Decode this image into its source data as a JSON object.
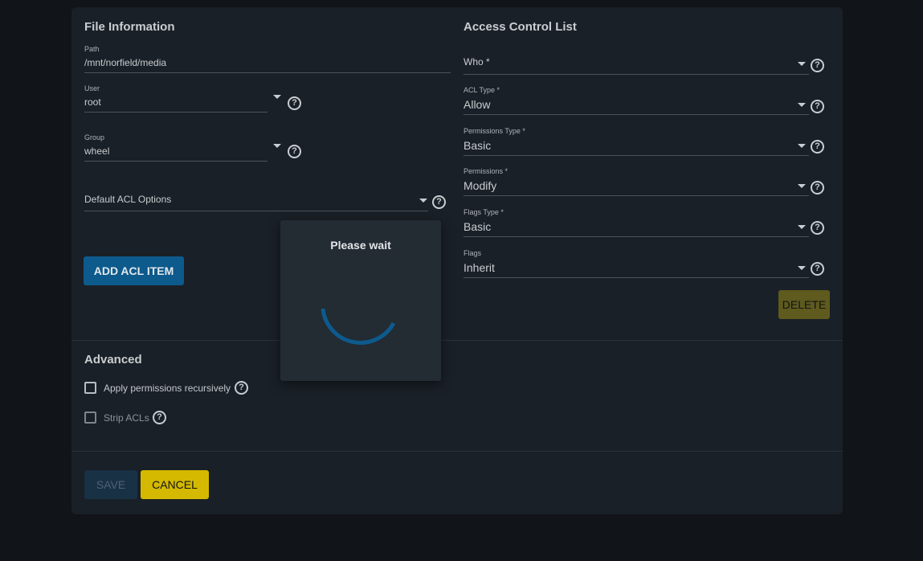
{
  "file_info": {
    "title": "File Information",
    "path": {
      "label": "Path",
      "value": "/mnt/norfield/media"
    },
    "user": {
      "label": "User",
      "value": "root"
    },
    "group": {
      "label": "Group",
      "value": "wheel"
    },
    "default_acl": {
      "placeholder": "Default ACL Options"
    },
    "add_button": "ADD ACL ITEM"
  },
  "acl": {
    "title": "Access Control List",
    "who": {
      "placeholder": "Who *"
    },
    "acl_type": {
      "label": "ACL Type *",
      "value": "Allow"
    },
    "permissions_type": {
      "label": "Permissions Type *",
      "value": "Basic"
    },
    "permissions": {
      "label": "Permissions *",
      "value": "Modify"
    },
    "flags_type": {
      "label": "Flags Type *",
      "value": "Basic"
    },
    "flags": {
      "label": "Flags",
      "value": "Inherit"
    },
    "delete_button": "DELETE"
  },
  "advanced": {
    "title": "Advanced",
    "apply_recursive": "Apply permissions recursively",
    "strip_acls": "Strip ACLs"
  },
  "actions": {
    "save": "SAVE",
    "cancel": "CANCEL"
  },
  "dialog": {
    "title": "Please wait"
  },
  "icons": {
    "help": "?"
  },
  "colors": {
    "primary": "#0d5a8c",
    "accent": "#d4b900",
    "background": "#111419",
    "card": "#1a2027"
  }
}
